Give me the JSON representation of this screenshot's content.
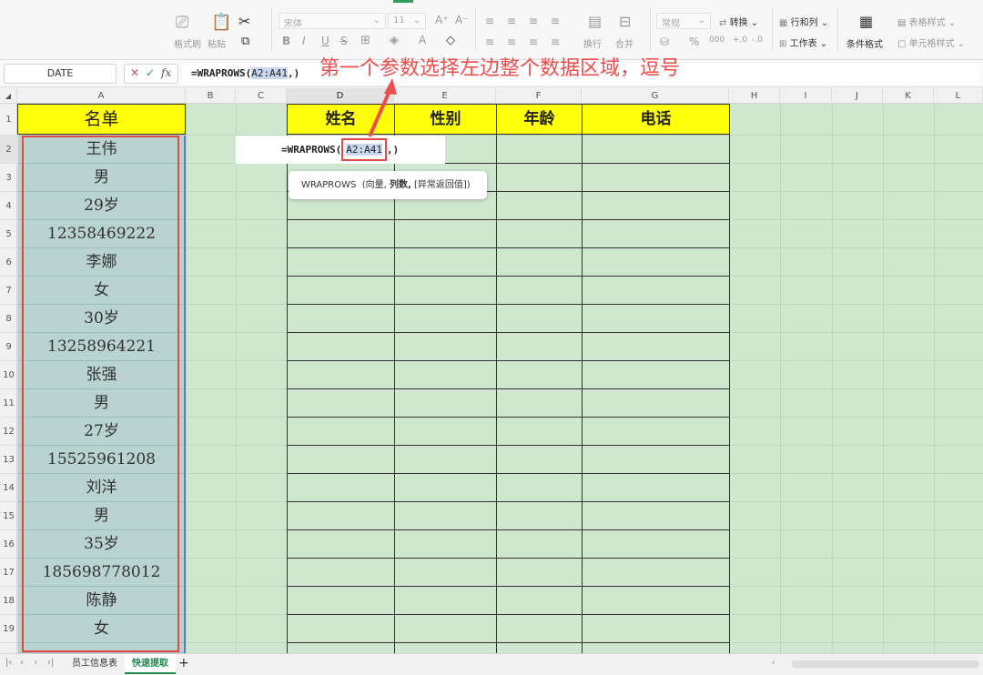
{
  "ribbon": {
    "format_painter": "格式刷",
    "paste": "粘贴",
    "font_name": "宋体",
    "font_size": "11",
    "wrap": "换行",
    "merge": "合并",
    "number_format": "常规",
    "convert": "转换",
    "rows_cols": "行和列",
    "worksheet": "工作表",
    "cond_format": "条件格式",
    "table_style": "表格样式",
    "cell_style": "单元格样式"
  },
  "formula_bar": {
    "name_box": "DATE",
    "cancel": "✕",
    "confirm": "✓",
    "fx": "fx",
    "formula_prefix": "=WRAPROWS(",
    "formula_ref": "A2:A41",
    "formula_suffix": ",)"
  },
  "annotation": "第一个参数选择左边整个数据区域，逗号",
  "columns": [
    "A",
    "B",
    "C",
    "D",
    "E",
    "F",
    "G",
    "H",
    "I",
    "J",
    "K",
    "L"
  ],
  "rows": [
    "1",
    "2",
    "3",
    "4",
    "5",
    "6",
    "7",
    "8",
    "9",
    "10",
    "11",
    "12",
    "13",
    "14",
    "15",
    "16",
    "17",
    "18",
    "19"
  ],
  "sheet": {
    "a_header": "名单",
    "a_values": [
      "王伟",
      "男",
      "29岁",
      "12358469222",
      "李娜",
      "女",
      "30岁",
      "13258964221",
      "张强",
      "男",
      "27岁",
      "15525961208",
      "刘洋",
      "男",
      "35岁",
      "185698778012",
      "陈静",
      "女"
    ],
    "table_headers": [
      "姓名",
      "性别",
      "年龄",
      "电话"
    ],
    "edit_prefix": "=WRAPROWS(",
    "edit_ref": "A2:A41",
    "edit_suffix": ",)",
    "tooltip_fn": "WRAPROWS",
    "tooltip_arg1": "(向量,",
    "tooltip_arg2": "列数,",
    "tooltip_arg3": "[异常返回值])"
  },
  "tabs": [
    "员工信息表",
    "快速提取"
  ],
  "active_tab": "快速提取"
}
